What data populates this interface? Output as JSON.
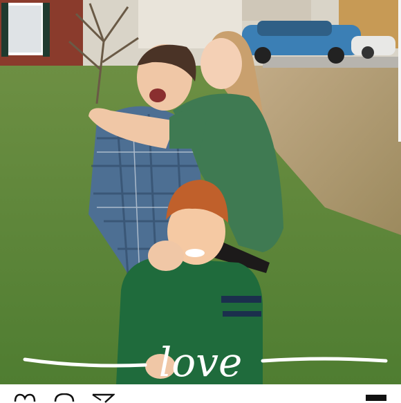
{
  "photo": {
    "overlay_text": "love",
    "colors": {
      "grass": "#5f8a3c",
      "lawn_dry": "#b9a27d",
      "green_shirt": "#3f7a52",
      "plaid_blue": "#4d6f93",
      "boy_sweater": "#1f6b3c",
      "car": "#3b7fb5",
      "hair_red": "#c0602b",
      "script_text": "#ffffff"
    }
  },
  "action_bar": {
    "icons": [
      "heart-icon",
      "comment-icon",
      "share-icon",
      "bookmark-icon"
    ]
  }
}
